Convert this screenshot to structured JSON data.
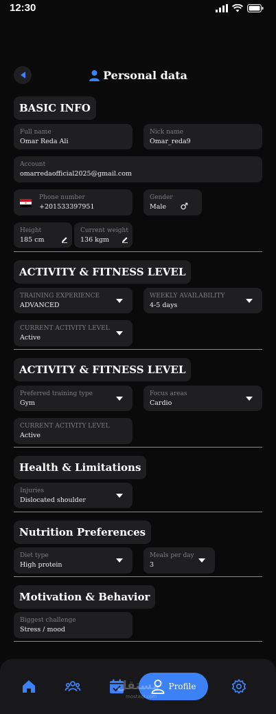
{
  "status_bar": {
    "time": "12:30"
  },
  "header": {
    "title": "Personal data"
  },
  "basic_info": {
    "title": "BASIC INFO",
    "full_name": {
      "label": "Full name",
      "value": "Omar Reda Ali"
    },
    "nick_name": {
      "label": "Nick name",
      "value": "Omar_reda9"
    },
    "account": {
      "label": "Account",
      "value": "omarredaofficial2025@gmail.com"
    },
    "phone": {
      "label": "Phone number",
      "value": "+201533397951"
    },
    "gender": {
      "label": "Gender",
      "value": "Male"
    },
    "height": {
      "label": "Height",
      "value": "185 cm"
    },
    "weight": {
      "label": "Current weight",
      "value": "136 kgm"
    }
  },
  "activity_1": {
    "title": "ACTIVITY & FITNESS LEVEL",
    "training_experience": {
      "label": "TRAINING EXPERIENCE",
      "value": "ADVANCED"
    },
    "weekly_availability": {
      "label": "WEEKLY AVAILABILITY",
      "value": "4-5 days"
    },
    "current_activity": {
      "label": "CURRENT ACTIVITY LEVEL",
      "value": "Active"
    }
  },
  "activity_2": {
    "title": "ACTIVITY & FITNESS LEVEL",
    "training_type": {
      "label": "Preferred training type",
      "value": "Gym"
    },
    "focus_areas": {
      "label": "Focus areas",
      "value": "Cardio"
    },
    "current_activity": {
      "label": "CURRENT ACTIVITY LEVEL",
      "value": "Active"
    }
  },
  "health": {
    "title": "Health & Limitations",
    "injuries": {
      "label": "Injuries",
      "value": "Dislocated shoulder"
    }
  },
  "nutrition": {
    "title": "Nutrition Preferences",
    "diet_type": {
      "label": "Diet type",
      "value": "High protein"
    },
    "meals_per_day": {
      "label": "Meals per day",
      "value": "3"
    }
  },
  "motivation": {
    "title": "Motivation & Behavior",
    "biggest_challenge": {
      "label": "Biggest challenge",
      "value": "Stress / mood"
    }
  },
  "nav": {
    "active_label": "Profile",
    "accent_color": "#3c82f6",
    "items": [
      "home-icon",
      "community-icon",
      "calendar-icon",
      "profile-icon",
      "settings-icon"
    ]
  },
  "watermark": {
    "text": "مستقل",
    "sub": "mostaql.com"
  }
}
